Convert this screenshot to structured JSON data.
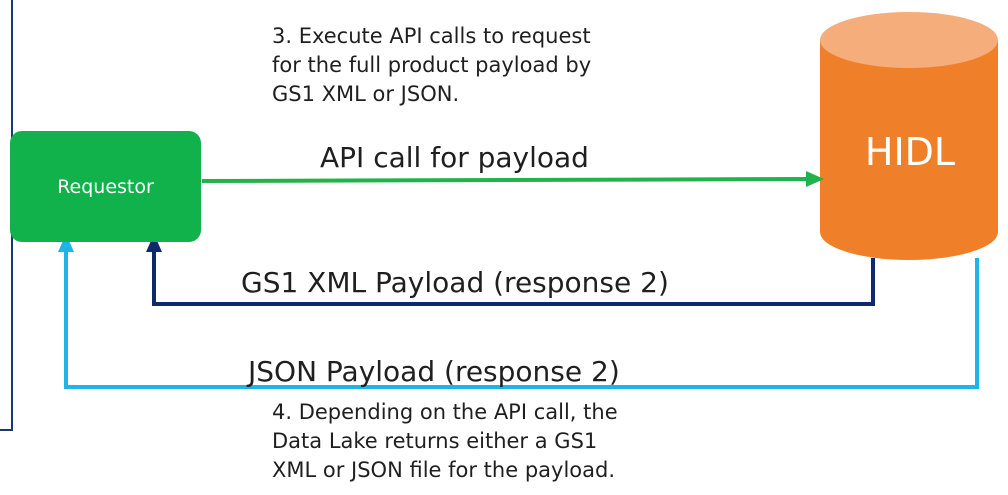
{
  "nodes": {
    "requestor": "Requestor",
    "hidl": "HIDL"
  },
  "steps": {
    "step3": "3. Execute API calls to request\nfor the full product payload by\nGS1 XML or JSON.",
    "step4": "4. Depending on the API call, the\nData Lake returns either a GS1\nXML or JSON file for the payload."
  },
  "edges": {
    "api_call": "API call for payload",
    "gs1_response": "GS1 XML Payload (response 2)",
    "json_response": "JSON Payload (response 2)"
  },
  "colors": {
    "requestor_fill": "#11b14b",
    "database_fill": "#f07f2a",
    "database_top": "#f5ad7c",
    "api_arrow": "#22b24c",
    "gs1_arrow": "#0d2a6b",
    "json_arrow": "#1eb4e8",
    "frame_line": "#1a3a6e"
  }
}
